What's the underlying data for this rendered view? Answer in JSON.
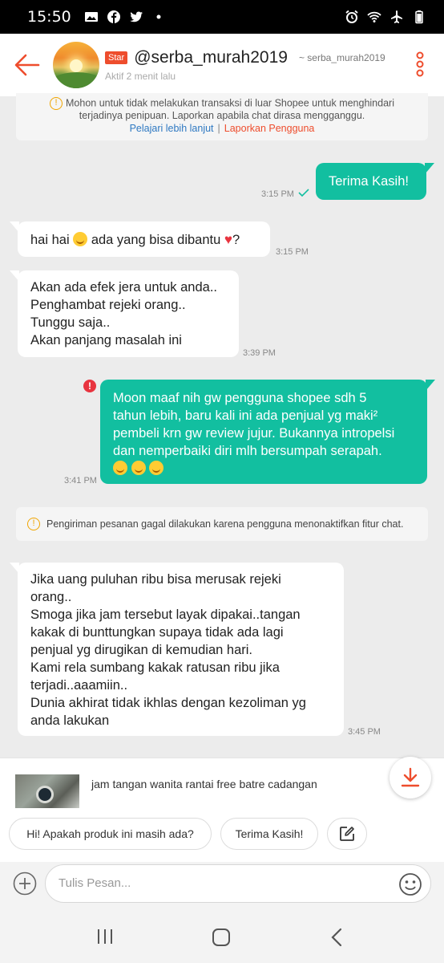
{
  "status_bar": {
    "time": "15:50",
    "left_icons": [
      "image-icon",
      "facebook-icon",
      "twitter-icon",
      "dot-icon"
    ],
    "right_icons": [
      "alarm-icon",
      "wifi-icon",
      "airplane-icon",
      "battery-icon"
    ]
  },
  "header": {
    "badge": "Star",
    "username": "@serba_murah2019",
    "alias": "~ serba_murah2019",
    "status": "Aktif 2 menit lalu",
    "accent": "#ee4d2d"
  },
  "notice": {
    "line1": "Mohon untuk tidak melakukan transaksi di luar Shopee untuk menghindari",
    "line2": "terjadinya penipuan. Laporkan apabila chat dirasa mengganggu.",
    "link_learn": "Pelajari lebih lanjut",
    "separator": "|",
    "link_report": "Laporkan Pengguna"
  },
  "messages": [
    {
      "from": "me",
      "lines": [
        "Terima Kasih!"
      ],
      "time": "3:15 PM"
    },
    {
      "from": "seller",
      "lines": [
        "hai hai",
        "ada yang bisa dibantu",
        "?"
      ],
      "time": "3:15 PM"
    },
    {
      "from": "seller",
      "lines": [
        "Akan ada efek jera untuk anda..",
        "Penghambat rejeki orang..",
        "Tunggu saja..",
        "Akan panjang masalah ini"
      ],
      "time": "3:39 PM"
    },
    {
      "from": "me",
      "lines": [
        "Moon maaf nih gw pengguna shopee sdh 5",
        "tahun lebih, baru kali ini ada penjual yg maki²",
        "pembeli krn gw review jujur. Bukannya intropelsi",
        "dan nemperbaiki diri mlh bersumpah serapah."
      ],
      "time": "3:41 PM",
      "failed": true
    },
    {
      "from": "seller",
      "lines": [
        "Jika uang puluhan ribu bisa merusak rejeki",
        "orang..",
        "Smoga jika jam tersebut layak dipakai..tangan",
        "kakak di bunttungkan supaya tidak ada lagi",
        "penjual yg dirugikan di kemudian hari.",
        "Kami rela sumbang kakak ratusan ribu jika",
        "terjadi..aaamiin..",
        "Dunia akhirat tidak ikhlas dengan kezoliman yg",
        "anda lakukan"
      ],
      "time": "3:45 PM"
    }
  ],
  "system_message": "Pengiriman pesanan gagal dilakukan karena pengguna menonaktifkan fitur chat.",
  "product": {
    "title": "jam tangan wanita rantai free batre cadangan"
  },
  "quick_replies": [
    "Hi! Apakah produk ini masih ada?",
    "Terima Kasih!"
  ],
  "input": {
    "placeholder": "Tulis Pesan..."
  },
  "colors": {
    "outgoing_bubble": "#12bfa0",
    "incoming_bubble": "#ffffff",
    "chat_background": "#ececec",
    "error": "#e8343f"
  }
}
